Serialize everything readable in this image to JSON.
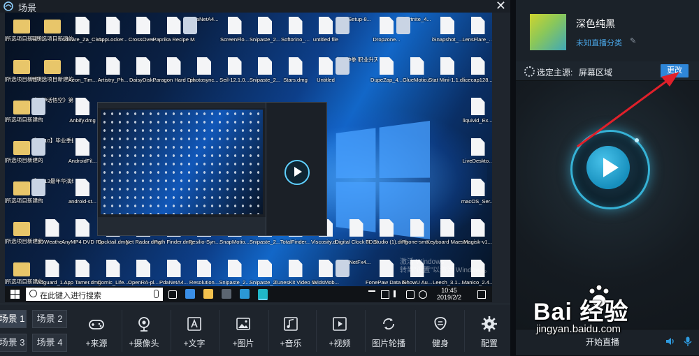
{
  "window": {
    "title": "场景"
  },
  "desktop": {
    "icons": [
      {
        "label": "用所选项目新建的文件夹",
        "kind": "folder"
      },
      {
        "label": "用所选项目新建的文件夹",
        "kind": "folder"
      },
      {
        "label": "Adware_Za_Cleaner_2...",
        "kind": "file"
      },
      {
        "label": "AppLocker...",
        "kind": "file"
      },
      {
        "label": "CrossOver...",
        "kind": "file"
      },
      {
        "label": "Paprika Recipe Ma...",
        "kind": "file"
      },
      {
        "label": "PdaNetA4...",
        "kind": "app"
      },
      {
        "label": "ScreenFlo...",
        "kind": "file"
      },
      {
        "label": "Snipaste_2...",
        "kind": "file"
      },
      {
        "label": "Softorino_...",
        "kind": "file"
      },
      {
        "label": "untitled file",
        "kind": "file"
      },
      {
        "label": "YYSetup-8...",
        "kind": "app"
      },
      {
        "label": "Dropzone...",
        "kind": "file"
      },
      {
        "label": "Fortnite_4...",
        "kind": "app"
      },
      {
        "label": "iSnapshot_...",
        "kind": "file"
      },
      {
        "label": "LensFlare_...",
        "kind": "file"
      },
      {
        "label": "用所选项目新建的文件夹",
        "kind": "folder"
      },
      {
        "label": "用所选项目新建的文件夹",
        "kind": "folder"
      },
      {
        "label": "Aeon_Tim...",
        "kind": "file"
      },
      {
        "label": "Artistry_Ph...",
        "kind": "file"
      },
      {
        "label": "DaisyDisk...",
        "kind": "file"
      },
      {
        "label": "Paragon Hard Disk...",
        "kind": "file"
      },
      {
        "label": "photosync...",
        "kind": "file"
      },
      {
        "label": "Seil-12.1.0...",
        "kind": "file"
      },
      {
        "label": "Snipaste_2...",
        "kind": "file"
      },
      {
        "label": "Stars.dmg",
        "kind": "file"
      },
      {
        "label": "Untitled",
        "kind": "file"
      },
      {
        "label": "北斗神拳 职业升天...",
        "kind": "app"
      },
      {
        "label": "DupeZap_4...",
        "kind": "file"
      },
      {
        "label": "GlueMotio...",
        "kind": "file"
      },
      {
        "label": "iStat Mini-1.1.d...",
        "kind": "file"
      },
      {
        "label": "licecap128...",
        "kind": "file"
      },
      {
        "label": "用所选项目新建的文件夹 6",
        "kind": "folder"
      },
      {
        "label": "《黑神话悟空》第6期...",
        "kind": "app"
      },
      {
        "label": "Anbify.dmg",
        "kind": "file"
      },
      {
        "label": "liquivid_Ex...",
        "kind": "file"
      },
      {
        "label": "用所选项目新建的文件夹 7",
        "kind": "folder"
      },
      {
        "label": "【EP.10】毕业季摄影...",
        "kind": "app"
      },
      {
        "label": "AndroidFil...",
        "kind": "file"
      },
      {
        "label": "LiveDeskto...",
        "kind": "file"
      },
      {
        "label": "用所选项目新建的文件夹 8",
        "kind": "folder"
      },
      {
        "label": "【EP.13最年华演绎...",
        "kind": "app"
      },
      {
        "label": "android-st...",
        "kind": "file"
      },
      {
        "label": "macOS_Ser...",
        "kind": "file"
      },
      {
        "label": "用所选项目新建的文件夹 9",
        "kind": "folder"
      },
      {
        "label": "3DWeathe...",
        "kind": "file"
      },
      {
        "label": "AnyMP4 DVD Ripp...",
        "kind": "file"
      },
      {
        "label": "Cocktail.dmg",
        "kind": "file"
      },
      {
        "label": "Net Radar.dmg",
        "kind": "file"
      },
      {
        "label": "Path Finder.dmg",
        "kind": "file"
      },
      {
        "label": "Resilio-Syn...",
        "kind": "file"
      },
      {
        "label": "SnapMotio...",
        "kind": "file"
      },
      {
        "label": "Snipaste_2...",
        "kind": "file"
      },
      {
        "label": "TotalFinder...",
        "kind": "file"
      },
      {
        "label": "Viscosity.d...",
        "kind": "file"
      },
      {
        "label": "Digital Clock 3D.dmg",
        "kind": "file"
      },
      {
        "label": "FL Studio (1).dmg",
        "kind": "file"
      },
      {
        "label": "iPhone-sms...",
        "kind": "file"
      },
      {
        "label": "Keyboard Maestro-8...",
        "kind": "file"
      },
      {
        "label": "Magisk-v1...",
        "kind": "file"
      },
      {
        "label": "用所选项目新建的文件夹",
        "kind": "folder"
      },
      {
        "label": "Adguard_1...",
        "kind": "file"
      },
      {
        "label": "App Tamer.dmg",
        "kind": "file"
      },
      {
        "label": "Comic_Life...",
        "kind": "file"
      },
      {
        "label": "OpenRA-pl...",
        "kind": "file"
      },
      {
        "label": "PdaNetA4...",
        "kind": "file"
      },
      {
        "label": "Resolution...",
        "kind": "file"
      },
      {
        "label": "Snipaste_2...",
        "kind": "file"
      },
      {
        "label": "Snipaste_2...",
        "kind": "file"
      },
      {
        "label": "TunesKit Video Cu...",
        "kind": "file"
      },
      {
        "label": "WidsMob...",
        "kind": "file"
      },
      {
        "label": "dotNetFx4...",
        "kind": "app"
      },
      {
        "label": "FonePaw Data Recov...",
        "kind": "file"
      },
      {
        "label": "iShowU Au...",
        "kind": "file"
      },
      {
        "label": "Leech_3.1...",
        "kind": "file"
      },
      {
        "label": "Manico_2.4...",
        "kind": "file"
      }
    ],
    "activation_watermark": [
      "激活 Windows",
      "转到\"设置\"以激活 Windows。"
    ],
    "taskbar": {
      "search_placeholder": "在此键入进行搜索",
      "time": "10:45",
      "date": "2019/2/2"
    }
  },
  "scenes": [
    "场景 1",
    "场景 2",
    "场景 3",
    "场景 4"
  ],
  "tools": [
    {
      "label": "+来源",
      "icon": "gamepad-icon"
    },
    {
      "label": "+摄像头",
      "icon": "webcam-icon"
    },
    {
      "label": "+文字",
      "icon": "text-icon"
    },
    {
      "label": "+图片",
      "icon": "image-icon"
    },
    {
      "label": "+音乐",
      "icon": "music-icon"
    },
    {
      "label": "+视频",
      "icon": "video-icon"
    },
    {
      "label": "图片轮播",
      "icon": "slideshow-icon"
    },
    {
      "label": "健身",
      "icon": "fitness-icon"
    },
    {
      "label": "配置",
      "icon": "gear-icon"
    }
  ],
  "live_panel": {
    "room_name": "深色纯黑",
    "category": "未知直播分类",
    "source_label": "选定主源:",
    "source_value": "屏幕区域",
    "change_button": "更改",
    "start_live": "开始直播"
  },
  "watermark": {
    "brand": "Bai 经验",
    "url": "jingyan.baidu.com"
  },
  "colors": {
    "accent": "#2e86d8",
    "play_ring": "#36b2d6",
    "annotation_arrow": "#e0202a"
  }
}
